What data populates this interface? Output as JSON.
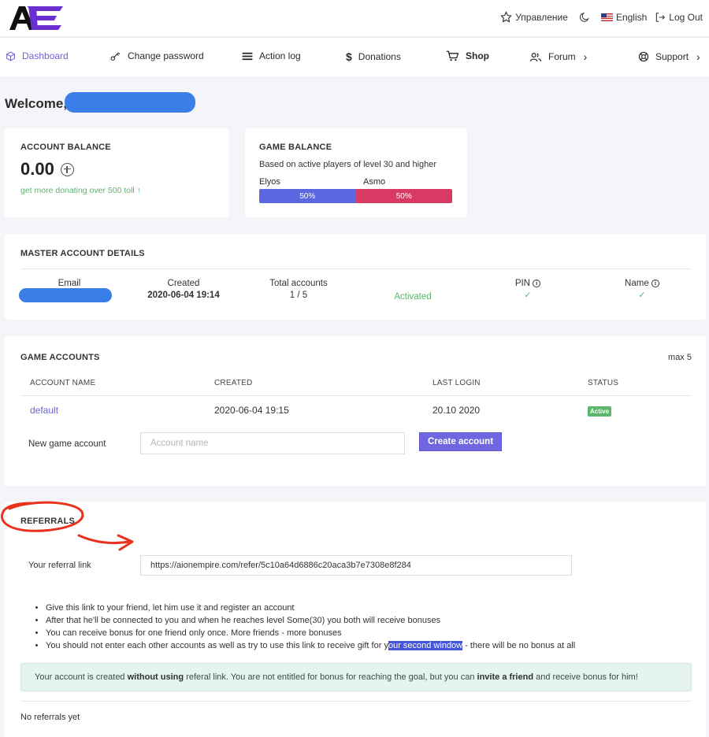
{
  "topbar": {
    "manage_label": "Управление",
    "language_label": "English",
    "logout_label": "Log Out"
  },
  "nav": {
    "dashboard": "Dashboard",
    "change_password": "Change password",
    "action_log": "Action log",
    "donations": "Donations",
    "shop": "Shop",
    "forum": "Forum",
    "support": "Support"
  },
  "welcome": "Welcome,",
  "account_balance": {
    "title": "ACCOUNT BALANCE",
    "value": "0.00",
    "link": "get more donating over 500 toll ↑"
  },
  "game_balance": {
    "title": "GAME BALANCE",
    "subtitle": "Based on active players of level 30 and higher",
    "elyos_label": "Elyos",
    "asmo_label": "Asmo",
    "elyos_pct": "50%",
    "asmo_pct": "50%",
    "elyos_share": 0.5,
    "elyos_color": "#5c67e0",
    "asmo_color": "#d93a64"
  },
  "master": {
    "title": "MASTER ACCOUNT DETAILS",
    "email_label": "Email",
    "created_label": "Created",
    "created_value": "2020-06-04 19:14",
    "total_label": "Total accounts",
    "total_value": "1 / 5",
    "status_value": "Activated",
    "pin_label": "PIN",
    "name_label": "Name",
    "check": "✓"
  },
  "game_accounts": {
    "title": "GAME ACCOUNTS",
    "max": "max 5",
    "headers": [
      "ACCOUNT NAME",
      "CREATED",
      "LAST LOGIN",
      "STATUS"
    ],
    "rows": [
      {
        "name": "default",
        "created": "2020-06-04 19:15",
        "last_login": "20.10 2020",
        "status": "Active"
      }
    ],
    "new_label": "New game account",
    "placeholder": "Account name",
    "create_button": "Create account"
  },
  "referrals": {
    "title": "REFERRALS",
    "link_label": "Your referral link",
    "link_value": "https://aionempire.com/refer/5c10a64d6886c20aca3b7e7308e8f284",
    "rules": [
      "Give this link to your friend, let him use it and register an account",
      "After that he'll be connected to you and when he reaches level Some(30) you both will receive bonuses",
      "You can receive bonus for one friend only once. More friends - more bonuses"
    ],
    "rule4_a": "You should not enter each other accounts as well as try to use this link to receive gift for y",
    "rule4_hl": "our second window",
    "rule4_b": " - there will be no bonus at all",
    "alert_a": "Your account is created ",
    "alert_b": "without using",
    "alert_c": " referal link. You are not entitled for bonus for reaching the goal, but you can ",
    "alert_d": "invite a friend",
    "alert_e": " and receive bonus for him!",
    "none": "No referrals yet"
  },
  "colors": {
    "accent": "#6f66e0",
    "success": "#5bb56a",
    "annotation": "#e8321e",
    "redaction": "#3a7fe8"
  }
}
